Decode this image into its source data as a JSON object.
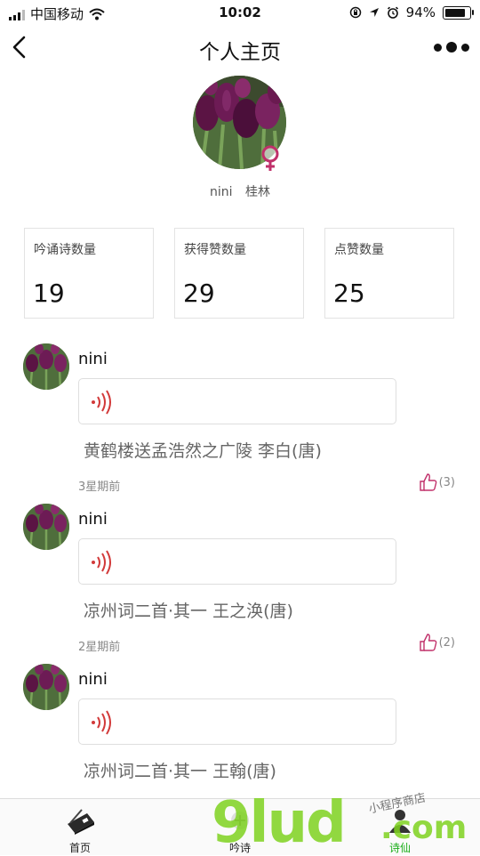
{
  "status_bar": {
    "carrier": "中国移动",
    "time": "10:02",
    "battery": "94%",
    "battery_level": 0.94,
    "icons": [
      "signal-icon",
      "wifi-icon",
      "orientation-lock-icon",
      "location-icon",
      "alarm-icon",
      "battery-icon"
    ]
  },
  "nav": {
    "title": "个人主页",
    "back_icon": "chevron-left-icon",
    "more_icon": "more-dots-icon"
  },
  "profile": {
    "name": "nini",
    "city": "桂林",
    "gender_icon": "female-symbol-icon",
    "accent_color": "#c0306a"
  },
  "stats": [
    {
      "label": "吟诵诗数量",
      "value": "19"
    },
    {
      "label": "获得赞数量",
      "value": "29"
    },
    {
      "label": "点赞数量",
      "value": "25"
    }
  ],
  "posts": [
    {
      "name": "nini",
      "poem": "黄鹤楼送孟浩然之广陵  李白(唐)",
      "time": "3星期前",
      "likes": "(3)"
    },
    {
      "name": "nini",
      "poem": "凉州词二首·其一  王之涣(唐)",
      "time": "2星期前",
      "likes": "(2)"
    },
    {
      "name": "nini",
      "poem": "凉州词二首·其一  王翰(唐)",
      "time": "",
      "likes": ""
    }
  ],
  "tabbar": {
    "tabs": [
      {
        "label": "首页",
        "icon": "home-icon"
      },
      {
        "label": "吟诗",
        "icon": "recite-icon"
      },
      {
        "label": "诗仙",
        "icon": "poet-icon"
      }
    ],
    "active_index": 2,
    "active_color": "#1aad19"
  },
  "watermark": {
    "main": "9lud",
    "suffix": ".com",
    "small": "小程序商店"
  }
}
